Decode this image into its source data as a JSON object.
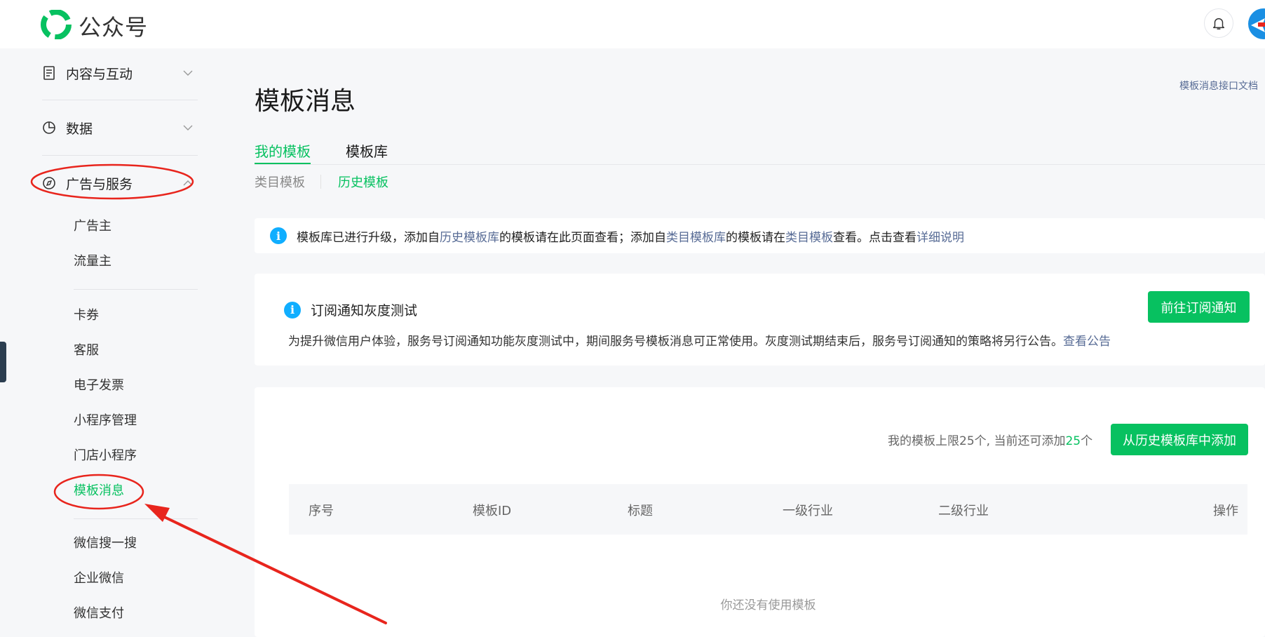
{
  "header": {
    "brand": "公众号",
    "icons": {
      "logo": "wechat-mp-logo",
      "bell": "bell-icon",
      "avatar": "avatar"
    }
  },
  "sidebar": {
    "groups": [
      {
        "label": "内容与互动",
        "icon": "document-icon"
      },
      {
        "label": "数据",
        "icon": "pie-chart-icon"
      },
      {
        "label": "广告与服务",
        "icon": "compass-icon"
      }
    ],
    "items": [
      {
        "label": "广告主"
      },
      {
        "label": "流量主"
      },
      {
        "label": "卡券"
      },
      {
        "label": "客服"
      },
      {
        "label": "电子发票"
      },
      {
        "label": "小程序管理"
      },
      {
        "label": "门店小程序"
      },
      {
        "label": "模板消息",
        "active": true
      },
      {
        "label": "微信搜一搜"
      },
      {
        "label": "企业微信"
      },
      {
        "label": "微信支付"
      }
    ]
  },
  "main": {
    "title": "模板消息",
    "doc_link": "模板消息接口文档",
    "tabs": [
      {
        "label": "我的模板",
        "active": true
      },
      {
        "label": "模板库",
        "active": false
      }
    ],
    "subtabs": [
      {
        "label": "类目模板",
        "active": false
      },
      {
        "label": "历史模板",
        "active": true
      }
    ],
    "notice": {
      "t1": "模板库已进行升级，添加自",
      "l1": "历史模板库",
      "t2": "的模板请在此页面查看；添加自",
      "l2": "类目模板库",
      "t3": "的模板请在",
      "l3": "类目模板",
      "t4": "查看。点击查看",
      "l4": "详细说明"
    },
    "subscription": {
      "title": "订阅通知灰度测试",
      "desc": "为提升微信用户体验，服务号订阅通知功能灰度测试中，期间服务号模板消息可正常使用。灰度测试期结束后，服务号订阅通知的策略将另行公告。",
      "link": "查看公告",
      "button": "前往订阅通知"
    },
    "templates": {
      "limit_prefix": "我的模板上限25个, 当前还可添加",
      "limit_remaining": "25",
      "limit_suffix": "个",
      "add_button": "从历史模板库中添加",
      "columns": [
        "序号",
        "模板ID",
        "标题",
        "一级行业",
        "二级行业",
        "操作"
      ],
      "empty": "你还没有使用模板"
    }
  },
  "colors": {
    "accent": "#07c160",
    "link": "#576b95",
    "info": "#10aeff",
    "annotation": "#e8251d"
  }
}
